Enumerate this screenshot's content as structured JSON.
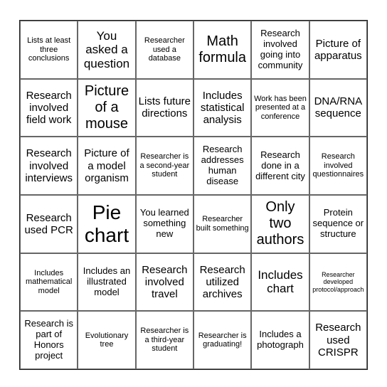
{
  "cells": [
    {
      "text": "Lists at least three conclusions",
      "size": "s1"
    },
    {
      "text": "You asked a question",
      "size": "s4"
    },
    {
      "text": "Researcher used a database",
      "size": "s1"
    },
    {
      "text": "Math formula",
      "size": "s5"
    },
    {
      "text": "Research involved going into community",
      "size": "s2"
    },
    {
      "text": "Picture of apparatus",
      "size": "s3"
    },
    {
      "text": "Research involved field work",
      "size": "s3"
    },
    {
      "text": "Picture of a mouse",
      "size": "s5"
    },
    {
      "text": "Lists future directions",
      "size": "s3"
    },
    {
      "text": "Includes statistical analysis",
      "size": "s3"
    },
    {
      "text": "Work has been presented at a conference",
      "size": "s1"
    },
    {
      "text": "DNA/RNA sequence",
      "size": "s3"
    },
    {
      "text": "Research involved interviews",
      "size": "s3"
    },
    {
      "text": "Picture of a model organism",
      "size": "s3"
    },
    {
      "text": "Researcher is a second-year student",
      "size": "s1"
    },
    {
      "text": "Research addresses human disease",
      "size": "s2"
    },
    {
      "text": "Research done in a different city",
      "size": "s2"
    },
    {
      "text": "Research involved questionnaires",
      "size": "s1"
    },
    {
      "text": "Research used PCR",
      "size": "s3"
    },
    {
      "text": "Pie chart",
      "size": "s6"
    },
    {
      "text": "You learned something new",
      "size": "s2"
    },
    {
      "text": "Researcher built something",
      "size": "s1"
    },
    {
      "text": "Only two authors",
      "size": "s5"
    },
    {
      "text": "Protein sequence or structure",
      "size": "s2"
    },
    {
      "text": "Includes mathematical model",
      "size": "s1"
    },
    {
      "text": "Includes an illustrated model",
      "size": "s2"
    },
    {
      "text": "Research involved travel",
      "size": "s3"
    },
    {
      "text": "Research utilized archives",
      "size": "s3"
    },
    {
      "text": "Includes chart",
      "size": "s4"
    },
    {
      "text": "Researcher developed protocol/approach",
      "size": "s0"
    },
    {
      "text": "Research is part of Honors project",
      "size": "s2"
    },
    {
      "text": "Evolutionary tree",
      "size": "s1"
    },
    {
      "text": "Researcher is a third-year student",
      "size": "s1"
    },
    {
      "text": "Researcher is graduating!",
      "size": "s1"
    },
    {
      "text": "Includes a photograph",
      "size": "s2"
    },
    {
      "text": "Research used CRISPR",
      "size": "s3"
    }
  ]
}
